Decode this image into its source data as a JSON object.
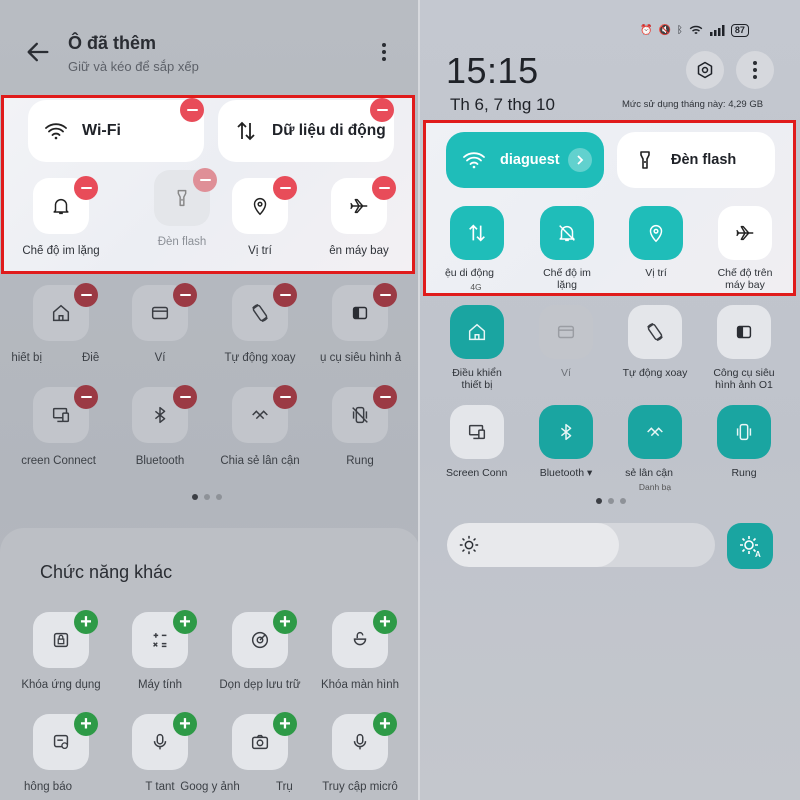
{
  "left": {
    "header": {
      "title": "Ô đã thêm",
      "subtitle": "Giữ và kéo để sắp xếp"
    },
    "highlight": {
      "wide_tiles": [
        {
          "label": "Wi-Fi",
          "icon": "wifi-icon"
        },
        {
          "label": "Dữ liệu di động",
          "icon": "mobile-data-icon"
        }
      ],
      "tiles": [
        {
          "label": "Chế độ im lặng",
          "icon": "bell-icon"
        },
        {
          "label": "Đèn flash",
          "icon": "flashlight-icon"
        },
        {
          "label": "Vị trí",
          "icon": "location-icon"
        },
        {
          "label": "ên máy bay",
          "icon": "airplane-icon"
        }
      ]
    },
    "row2": [
      {
        "label": "hiết bị",
        "extra": "Điề",
        "icon": "home-icon"
      },
      {
        "label": "Ví",
        "icon": "wallet-icon"
      },
      {
        "label": "Tự động xoay",
        "icon": "auto-rotate-icon"
      },
      {
        "label": "ụ cụ siêu hình ả",
        "icon": "split-screen-icon"
      }
    ],
    "row3": [
      {
        "label": "creen Connect",
        "icon": "screen-connect-icon"
      },
      {
        "label": "Bluetooth",
        "icon": "bluetooth-icon"
      },
      {
        "label": "Chia sẻ lân cận",
        "icon": "nearby-share-icon"
      },
      {
        "label": "Rung",
        "icon": "vibrate-icon"
      }
    ],
    "other": {
      "title": "Chức năng khác",
      "row1": [
        {
          "label": "Khóa ứng dụng",
          "icon": "app-lock-icon"
        },
        {
          "label": "Máy tính",
          "icon": "calculator-icon"
        },
        {
          "label": "Dọn dẹp lưu trữ",
          "icon": "storage-cleanup-icon"
        },
        {
          "label": "Khóa màn hình",
          "icon": "screen-lock-icon"
        }
      ],
      "row2": [
        {
          "label": "hông báo",
          "icon": "notification-icon"
        },
        {
          "label": "T   tant",
          "icon": "microphone-icon"
        },
        {
          "label": "Goog   y ảnh",
          "icon": "camera-icon"
        },
        {
          "label": "Truy cập micrô",
          "icon": "microphone-icon"
        }
      ],
      "row2_extra": "Trụ"
    }
  },
  "right": {
    "status": {
      "battery": "87"
    },
    "clock": "15:15",
    "date": "Th 6, 7 thg 10",
    "usage": "Mức sử dụng tháng này: 4,29 GB",
    "highlight": {
      "wide_tiles": [
        {
          "label": "diaguest",
          "icon": "wifi-icon",
          "active": true
        },
        {
          "label": "Đèn flash",
          "icon": "flashlight-icon",
          "active": false
        }
      ],
      "tiles": [
        {
          "label": "ệu di động",
          "sub": "4G",
          "icon": "mobile-data-icon"
        },
        {
          "label": "Chế độ im",
          "label2": "lặng",
          "icon": "bell-off-icon"
        },
        {
          "label": "Vị trí",
          "icon": "location-icon"
        },
        {
          "label": "Chế độ trên",
          "label2": "máy bay",
          "icon": "airplane-icon"
        }
      ]
    },
    "row2": [
      {
        "label": "Điều khiển",
        "label2": "thiết bị",
        "icon": "home-icon"
      },
      {
        "label": "Ví",
        "icon": "wallet-icon"
      },
      {
        "label": "Tự động xoay",
        "icon": "auto-rotate-icon"
      },
      {
        "label": "Công cụ siêu",
        "label2": "hình ảnh O1",
        "icon": "split-screen-icon"
      }
    ],
    "row3": [
      {
        "label": "Screen Conn",
        "icon": "screen-connect-icon"
      },
      {
        "label": "Bluetooth ▾",
        "icon": "bluetooth-icon"
      },
      {
        "label": "sẻ lân cận",
        "sub": "Danh bạ",
        "icon": "nearby-share-icon"
      },
      {
        "label": "Rung",
        "icon": "vibrate-icon"
      }
    ],
    "brightness_level": 0.64
  },
  "colors": {
    "accent_teal": "#1fbdb9",
    "highlight_border": "#e01b1b",
    "remove_badge": "#e84c59",
    "add_badge": "#2e9a47"
  }
}
